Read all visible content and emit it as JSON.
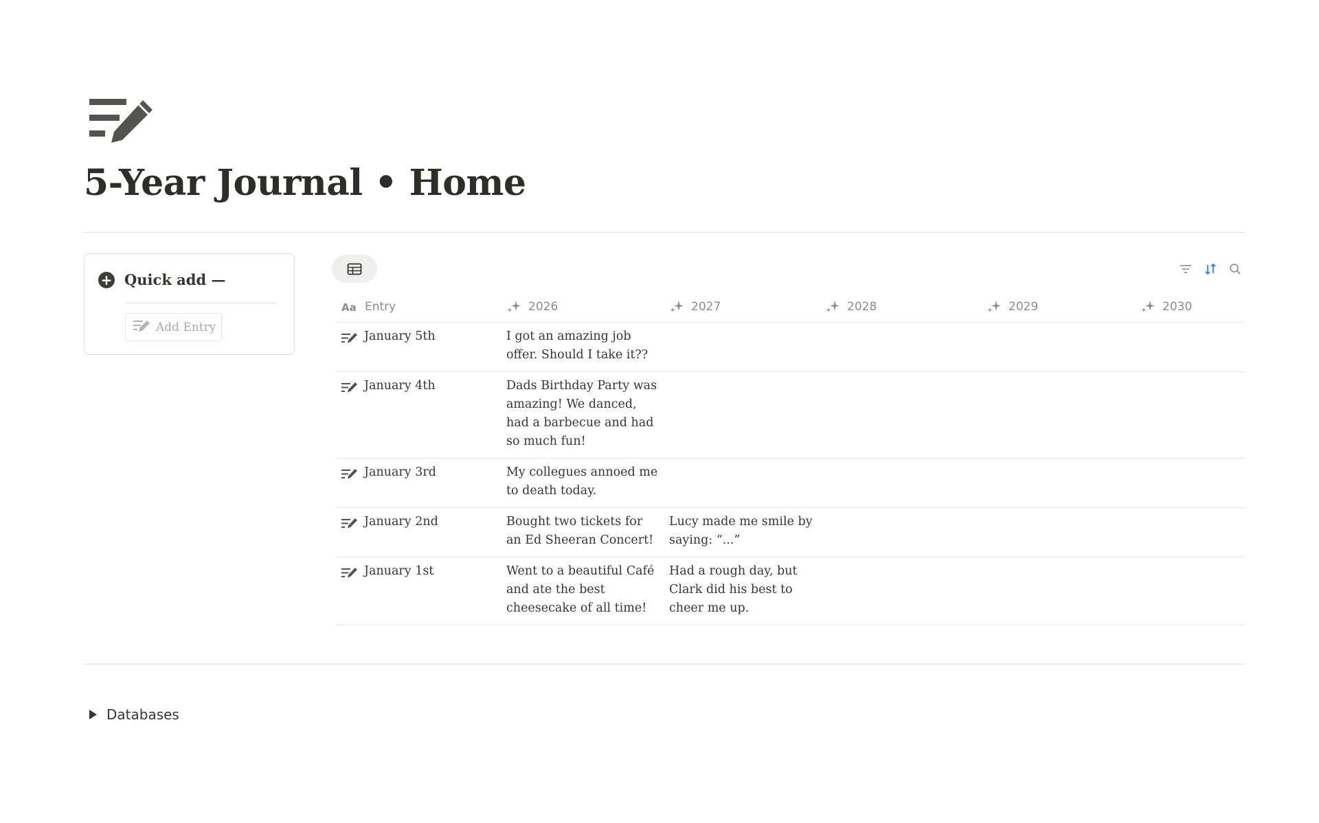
{
  "page": {
    "icon": "journal-pen-icon",
    "title": "5-Year Journal • Home"
  },
  "quick_add": {
    "label": "Quick add —",
    "icon": "plus-circle-icon",
    "button_label": "Add Entry",
    "button_icon": "journal-pen-icon"
  },
  "toolbar": {
    "view_icon": "table-view-icon",
    "tools": [
      "filter-icon",
      "sort-icon",
      "search-icon"
    ],
    "accent_color": "#2f80ed"
  },
  "table": {
    "columns": [
      {
        "label": "Entry",
        "icon": "text-property-icon"
      },
      {
        "label": "2026",
        "icon": "sparkle-icon"
      },
      {
        "label": "2027",
        "icon": "sparkle-icon"
      },
      {
        "label": "2028",
        "icon": "sparkle-icon"
      },
      {
        "label": "2029",
        "icon": "sparkle-icon"
      },
      {
        "label": "2030",
        "icon": "sparkle-icon"
      }
    ],
    "rows": [
      {
        "entry": "January 5th",
        "y2026": "I got an amazing job offer. Should I take it??",
        "y2027": "",
        "y2028": "",
        "y2029": "",
        "y2030": ""
      },
      {
        "entry": "January 4th",
        "y2026": "Dads Birthday Party was amazing! We danced, had a barbecue and had so much fun!",
        "y2027": "",
        "y2028": "",
        "y2029": "",
        "y2030": ""
      },
      {
        "entry": "January 3rd",
        "y2026": "My collegues annoed me to death today.",
        "y2027": "",
        "y2028": "",
        "y2029": "",
        "y2030": ""
      },
      {
        "entry": "January 2nd",
        "y2026": "Bought two tickets for an Ed Sheeran Concert!",
        "y2027": "Lucy made me smile by saying: “...”",
        "y2028": "",
        "y2029": "",
        "y2030": ""
      },
      {
        "entry": "January 1st",
        "y2026": "Went to a beautiful Café and ate the best cheesecake of all time!",
        "y2027": "Had a rough day, but Clark did his best to cheer me up.",
        "y2028": "",
        "y2029": "",
        "y2030": ""
      }
    ]
  },
  "footer": {
    "toggle_label": "Databases",
    "toggle_icon": "triangle-right-icon"
  }
}
